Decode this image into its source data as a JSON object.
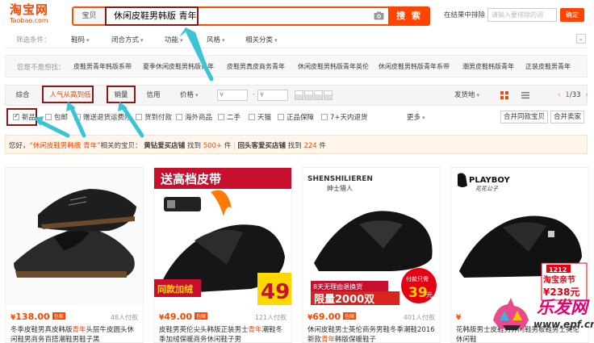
{
  "header": {
    "logo_text": "淘宝网",
    "logo_sub": "Taobao.com",
    "search_type": "宝贝",
    "search_value": "休闲皮鞋男韩版 青年",
    "search_button": "搜 索",
    "exclude_label": "在结果中排除",
    "exclude_placeholder": "请输入要排除的词",
    "confirm_button": "确定"
  },
  "filters": {
    "label": "筛选条件：",
    "items": [
      "鞋码",
      "闭合方式",
      "功能",
      "风格",
      "相关分类"
    ]
  },
  "suggest": {
    "label": "您是不是想找：",
    "items": [
      "皮鞋男青年韩版系带",
      "夏季休闲皮鞋男韩版青年",
      "皮鞋男真皮商务青年",
      "休闲皮鞋男韩版青年英伦",
      "休闲皮鞋男韩版青年系带",
      "潮男皮鞋韩版青年",
      "正装皮鞋男青年"
    ]
  },
  "sort": {
    "tabs": [
      "综合",
      "人气从高到低",
      "销量",
      "信用"
    ],
    "active_tab": "人气从高到低",
    "price_label": "价格",
    "price_unit": "¥",
    "dash": "-",
    "ship_label": "发货地",
    "page_current": "1",
    "page_total": "/33"
  },
  "checks": {
    "items": [
      "新品",
      "包邮",
      "赠送退货运费险",
      "货到付款",
      "海外商品",
      "二手",
      "天猫",
      "正品保障",
      "7+天内退货"
    ],
    "checked": [
      "新品"
    ],
    "more_label": "更多",
    "merge_buttons": [
      "合并同款宝贝",
      "合并卖家"
    ]
  },
  "tip": {
    "prefix": "您好，",
    "query": "“休闲皮鞋男韩版 青年”",
    "middle": "相关的宝贝：",
    "shop1": "黄钻爱买店铺",
    "found1": "找到",
    "count1": "500+",
    "unit1": "件",
    "sep": "|",
    "shop2": "回头客爱买店铺",
    "found2": "找到",
    "count2": "224",
    "unit2": "件"
  },
  "products": [
    {
      "price": "138.00",
      "currency": "¥",
      "mall": "包邮",
      "sales": "48人付款",
      "title_pre": "冬季皮鞋男真皮韩版",
      "title_hl": "青年",
      "title_post": "头层牛皮圆头休闲鞋男商务百搭潮鞋男鞋子黑"
    },
    {
      "price": "49.00",
      "currency": "¥",
      "mall": "包邮",
      "sales": "121人付款",
      "title_pre": "皮鞋男英伦尖头韩版正装男士",
      "title_hl": "青年",
      "title_post": "潮鞋冬季加绒保暖商务休闲鞋子男"
    },
    {
      "price": "69.00",
      "currency": "¥",
      "mall": "包邮",
      "sales": "401人付款",
      "title_pre": "休闲皮鞋男士英伦商务男鞋冬季潮鞋2016新款",
      "title_hl": "青年",
      "title_post": "韩版保暖鞋子"
    },
    {
      "price": "",
      "currency": "¥",
      "mall": "",
      "sales": "",
      "title_pre": "花",
      "title_hl": "",
      "title_post": "韩版男士皮鞋男休闲鞋男板鞋男士英伦休闲鞋"
    }
  ],
  "promo": {
    "p1_badge": "送高档皮带",
    "p1_tag": "同款加绒",
    "p1_price": "49",
    "p2_brand": "SHENSHILIEREN",
    "p2_brand_cn": "绅士猎人",
    "p2_banner": "8天无理由退换货",
    "p2_big": "限量2000双",
    "p2_pay": "付款只需",
    "p2_price": "39",
    "p2_yuan": "元",
    "p3_brand": "PLAYBOY",
    "p3_sub": "花花公子",
    "p3_tag": "1212",
    "p3_tag2": "淘宝亲节",
    "p3_price": "¥238元"
  },
  "watermark": {
    "text": "乐发网",
    "url": "www.epf.cn"
  },
  "colors": {
    "brand": "#ff4400",
    "annotation_box": "#8a1a1a",
    "annotation_arrow": "#3bc3d8"
  }
}
